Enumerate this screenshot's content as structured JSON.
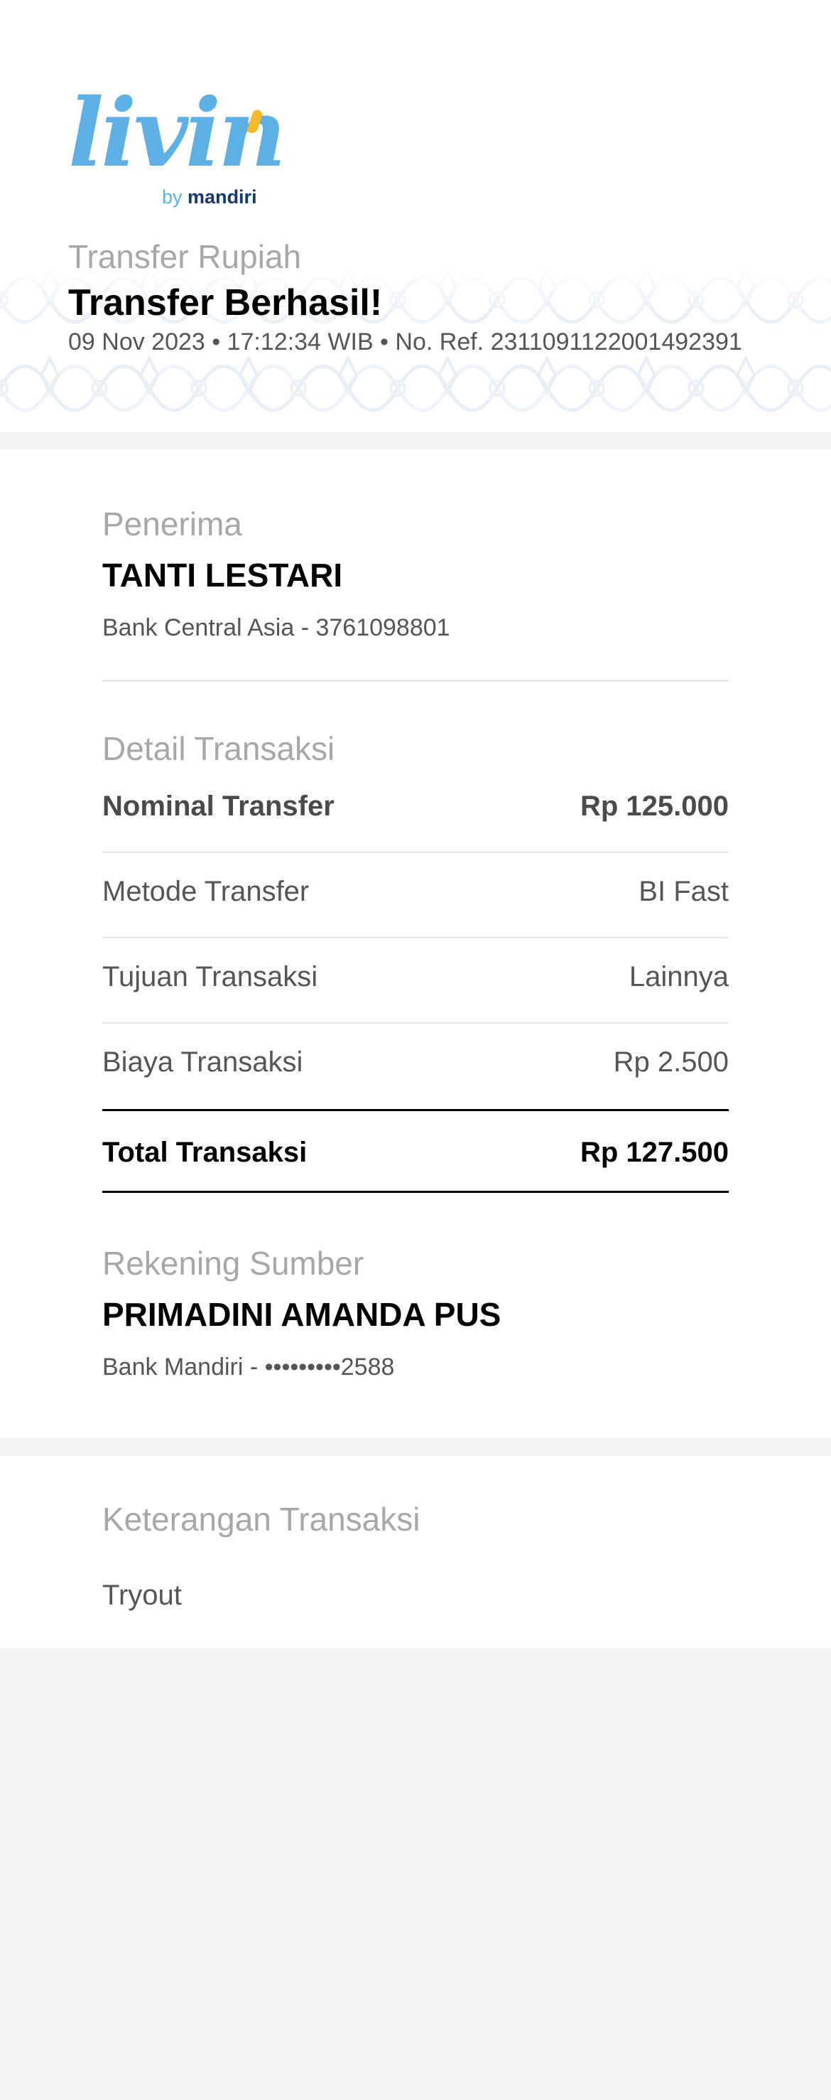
{
  "header": {
    "logo_text": "livin",
    "logo_by": "by",
    "logo_brand": "mandiri",
    "subtitle": "Transfer Rupiah",
    "title": "Transfer Berhasil!",
    "meta": "09 Nov 2023 • 17:12:34 WIB • No. Ref. 2311091122001492391"
  },
  "recipient": {
    "label": "Penerima",
    "name": "TANTI LESTARI",
    "account": "Bank Central Asia - 3761098801"
  },
  "details": {
    "label": "Detail Transaksi",
    "rows": [
      {
        "label": "Nominal Transfer",
        "value": "Rp 125.000"
      },
      {
        "label": "Metode Transfer",
        "value": "BI Fast"
      },
      {
        "label": "Tujuan Transaksi",
        "value": "Lainnya"
      },
      {
        "label": "Biaya Transaksi",
        "value": "Rp 2.500"
      }
    ],
    "total": {
      "label": "Total Transaksi",
      "value": "Rp 127.500"
    }
  },
  "source": {
    "label": "Rekening Sumber",
    "name": "PRIMADINI AMANDA PUS",
    "account": "Bank Mandiri - •••••••••2588"
  },
  "note": {
    "label": "Keterangan Transaksi",
    "text": "Tryout"
  },
  "colors": {
    "brand_blue": "#5cb0e6",
    "brand_navy": "#163a6b",
    "brand_yellow": "#f7b82a",
    "muted_label": "#a7a7aa",
    "body_text": "#555558",
    "page_bg": "#f4f3f4"
  }
}
